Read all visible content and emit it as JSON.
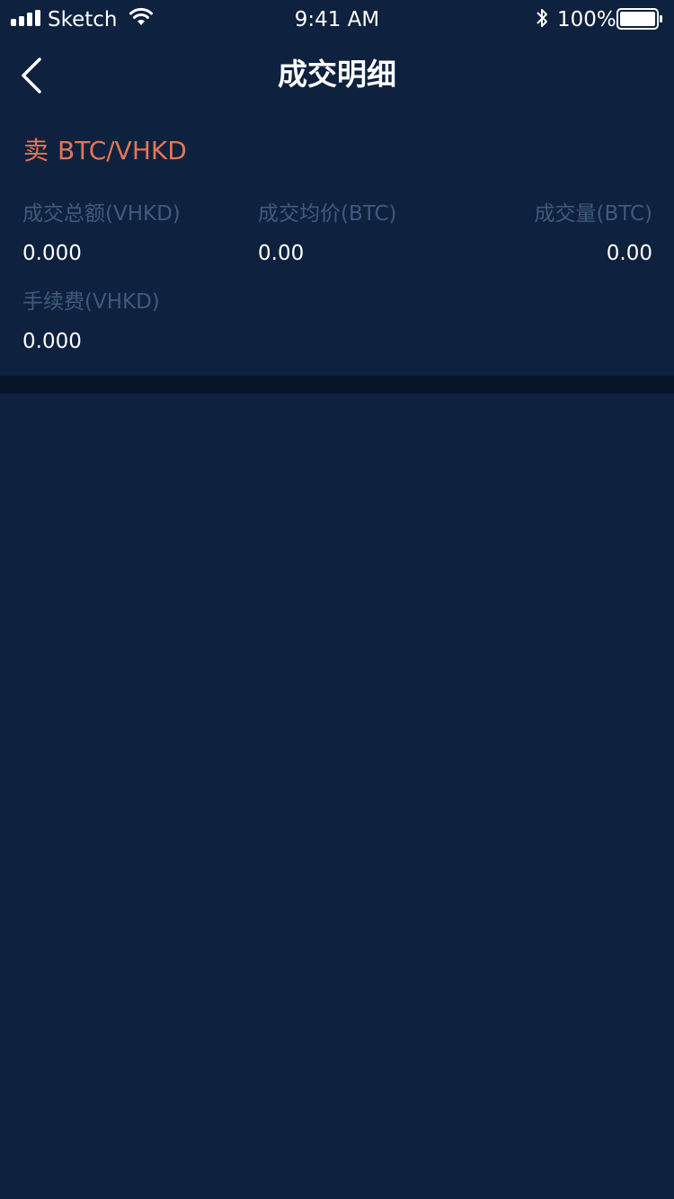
{
  "status_bar": {
    "carrier": "Sketch",
    "time": "9:41 AM",
    "battery_percent": "100%"
  },
  "header": {
    "title": "成交明细"
  },
  "pair": {
    "side": "卖",
    "name": "BTC/VHKD"
  },
  "stats": {
    "total_amount_label": "成交总额(VHKD)",
    "total_amount_value": "0.000",
    "avg_price_label": "成交均价(BTC)",
    "avg_price_value": "0.00",
    "volume_label": "成交量(BTC)",
    "volume_value": "0.00",
    "fee_label": "手续费(VHKD)",
    "fee_value": "0.000"
  },
  "colors": {
    "background": "#0e213e",
    "sell": "#e27655",
    "label": "#3f5a7e",
    "divider": "#081529"
  }
}
